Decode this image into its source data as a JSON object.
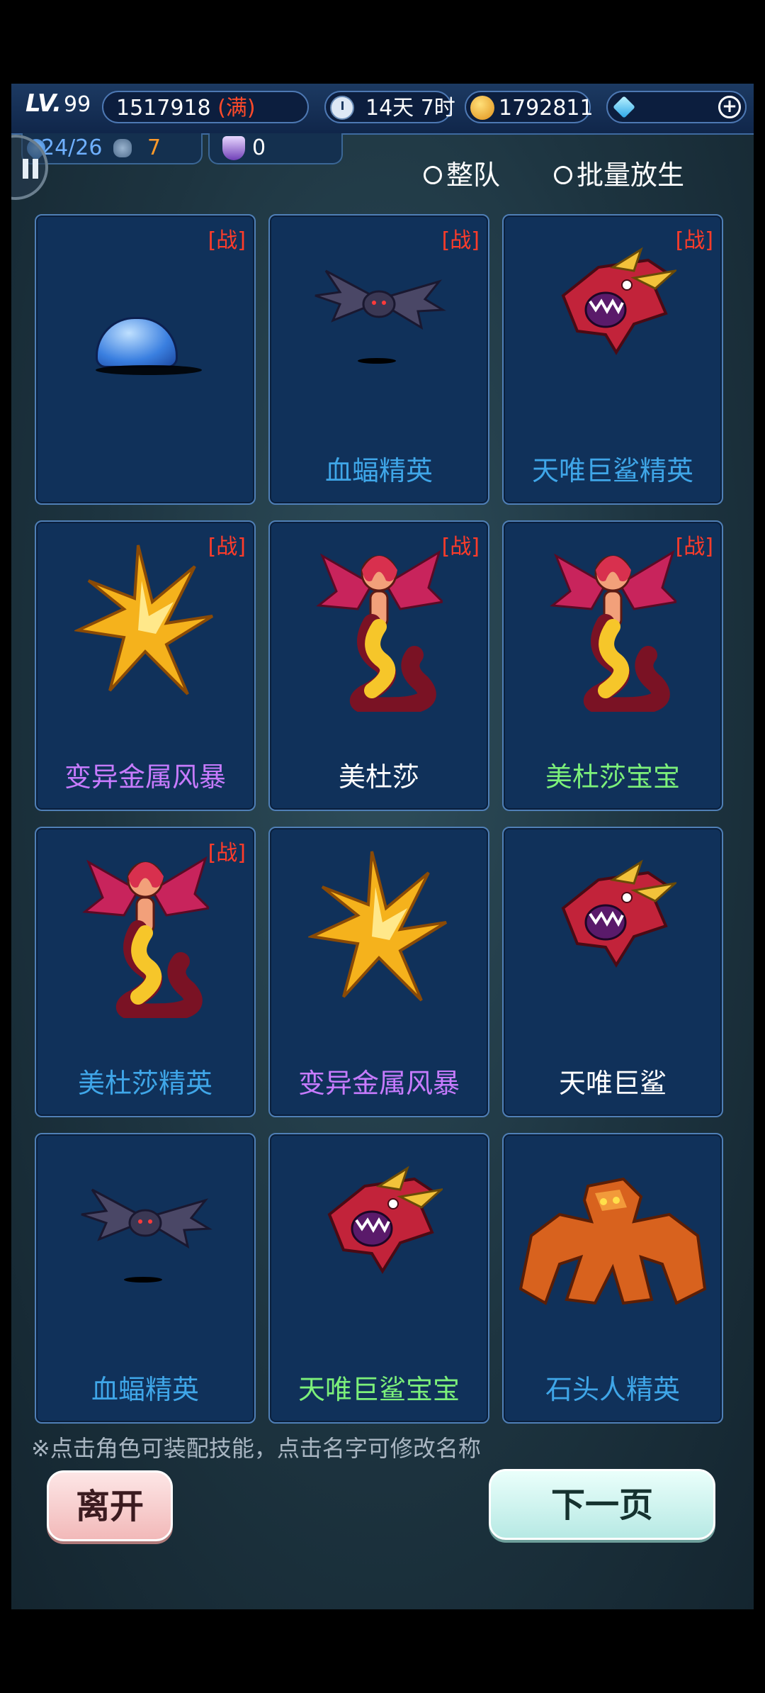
{
  "status": {
    "lv_label": "LV.",
    "lv_value": "99",
    "exp": "1517918",
    "exp_full": "(满)",
    "time": "14天 7时",
    "gold": "1792811",
    "capacity": "24/26",
    "souls": "7",
    "marks": "0"
  },
  "options": {
    "team": "整队",
    "release": "批量放生"
  },
  "icons": {
    "clock": "clock-icon",
    "coin": "coin-icon",
    "gem": "gem-icon",
    "add": "plus-icon",
    "pause": "pause-icon"
  },
  "battle_badge": "[战]",
  "pets": [
    {
      "name": "",
      "sprite": "blue-slime",
      "in_battle": true,
      "quality": "blue"
    },
    {
      "name": "血蝠精英",
      "sprite": "bat",
      "in_battle": true,
      "quality": "blue"
    },
    {
      "name": "天唯巨鲨精英",
      "sprite": "shark",
      "in_battle": true,
      "quality": "blue"
    },
    {
      "name": "变异金属风暴",
      "sprite": "storm",
      "in_battle": true,
      "quality": "purple"
    },
    {
      "name": "美杜莎",
      "sprite": "medusa",
      "in_battle": true,
      "quality": "white"
    },
    {
      "name": "美杜莎宝宝",
      "sprite": "medusa",
      "in_battle": true,
      "quality": "green"
    },
    {
      "name": "美杜莎精英",
      "sprite": "medusa",
      "in_battle": true,
      "quality": "blue"
    },
    {
      "name": "变异金属风暴",
      "sprite": "storm",
      "in_battle": false,
      "quality": "purple"
    },
    {
      "name": "天唯巨鲨",
      "sprite": "shark",
      "in_battle": false,
      "quality": "white"
    },
    {
      "name": "血蝠精英",
      "sprite": "bat",
      "in_battle": false,
      "quality": "blue"
    },
    {
      "name": "天唯巨鲨宝宝",
      "sprite": "shark",
      "in_battle": false,
      "quality": "green"
    },
    {
      "name": "石头人精英",
      "sprite": "golem",
      "in_battle": false,
      "quality": "blue"
    }
  ],
  "hint": "※点击角色可装配技能，点击名字可修改名称",
  "buttons": {
    "leave": "离开",
    "next": "下一页"
  },
  "colors": {
    "quality_blue": "#3fa6e8",
    "quality_purple": "#c77bff",
    "quality_white": "#ffffff",
    "quality_green": "#7cf07a",
    "battle_badge": "#ff3c2a"
  }
}
